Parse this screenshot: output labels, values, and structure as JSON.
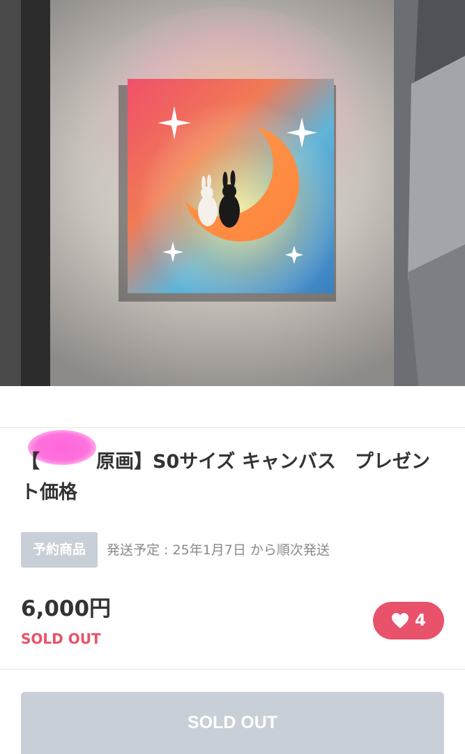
{
  "product": {
    "title": "【　　　原画】S0サイズ キャンバス　プレゼント価格",
    "badge": "予約商品",
    "shipping": "発送予定 : 25年1月7日 から順次発送",
    "price": "6,000円",
    "status": "SOLD OUT"
  },
  "like": {
    "count": "4",
    "icon": "heart-icon",
    "color": "#e8526b"
  },
  "buy_button": {
    "label": "SOLD OUT",
    "color": "#c8cfd6"
  }
}
